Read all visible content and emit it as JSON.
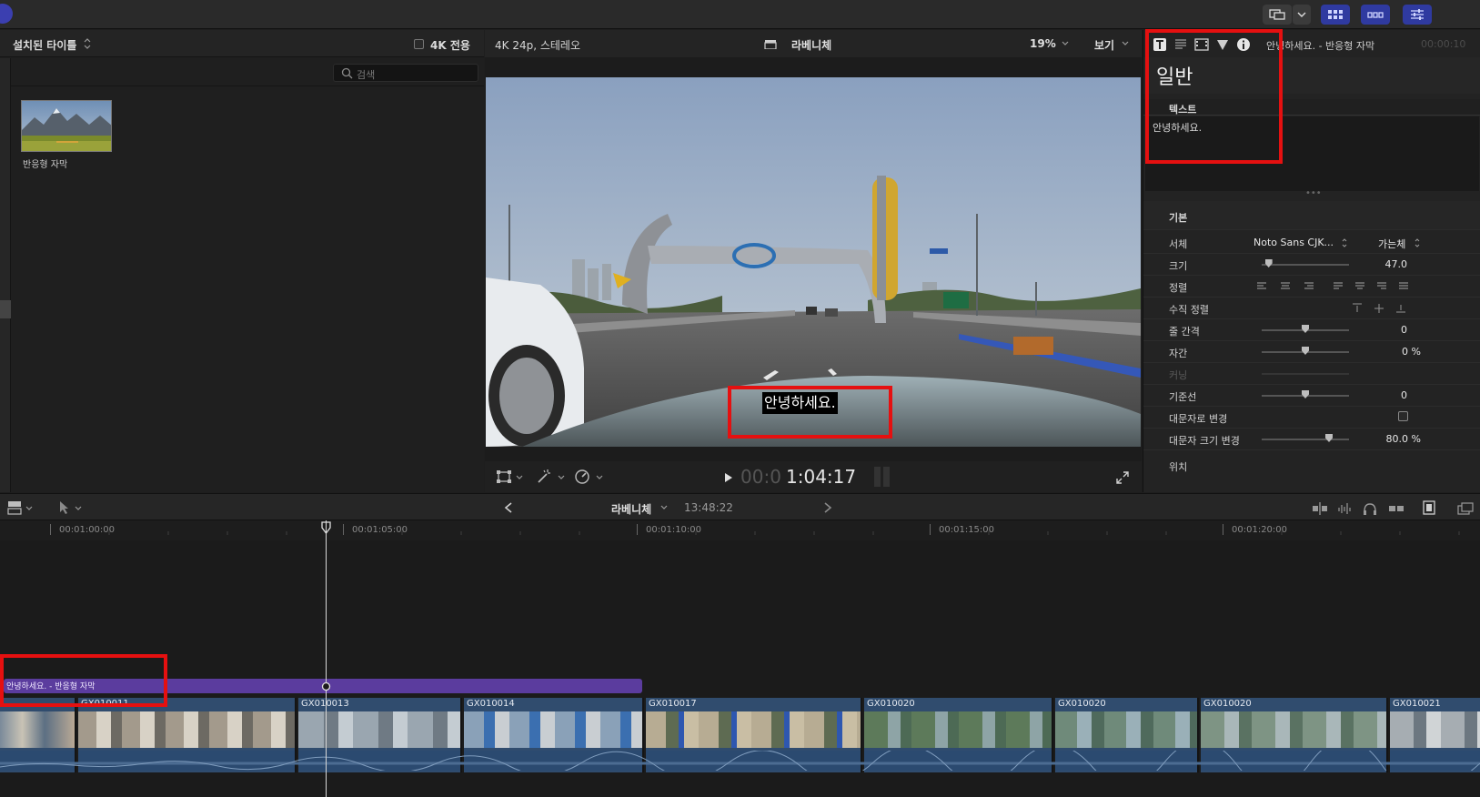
{
  "browser": {
    "title": "설치된 타이틀",
    "filter_4k": "4K 전용",
    "search_placeholder": "검색",
    "items": [
      {
        "label": "반응형 자막"
      }
    ]
  },
  "viewer": {
    "format": "4K 24p, 스테레오",
    "project_name": "라베니체",
    "zoom": "19%",
    "view_menu": "보기",
    "caption": "안녕하세요.",
    "timecode_dim": "00:0",
    "timecode": "1:04:17"
  },
  "inspector": {
    "header_title": "안녕하세요. - 반응형 자막",
    "header_time": "00:00:10",
    "section_title": "일반",
    "text_label": "텍스트",
    "text_value": "안녕하세요.",
    "basic_label": "기본",
    "font_label": "서체",
    "font_value": "Noto Sans CJK...",
    "font_weight": "가는체",
    "size_label": "크기",
    "size_value": "47.0",
    "size_level": 0.08,
    "align_label": "정렬",
    "valign_label": "수직 정렬",
    "line_spacing_label": "줄 간격",
    "line_spacing_value": "0",
    "tracking_label": "자간",
    "tracking_value": "0 %",
    "kerning_label": "커닝",
    "baseline_label": "기준선",
    "baseline_value": "0",
    "all_caps_label": "대문자로 변경",
    "all_caps_size_label": "대문자 크기 변경",
    "all_caps_size_value": "80.0 %",
    "position_label": "위치"
  },
  "timeline": {
    "project_name": "라베니체",
    "duration": "13:48:22",
    "ruler": [
      "00:01:00:00",
      "00:01:05:00",
      "00:01:10:00",
      "00:01:15:00",
      "00:01:20:00"
    ],
    "title_clip": "안녕하세요. - 반응형 자막",
    "clips": [
      {
        "name": ""
      },
      {
        "name": "GX010011"
      },
      {
        "name": "GX010013"
      },
      {
        "name": "GX010014"
      },
      {
        "name": "GX010017"
      },
      {
        "name": "GX010020"
      },
      {
        "name": "GX010020"
      },
      {
        "name": "GX010020"
      },
      {
        "name": "GX010021"
      }
    ]
  },
  "colors": {
    "accent": "#2f3aa0",
    "title_clip": "#5b3c9e",
    "video_clip": "#304c6e",
    "highlight": "#e51010"
  }
}
